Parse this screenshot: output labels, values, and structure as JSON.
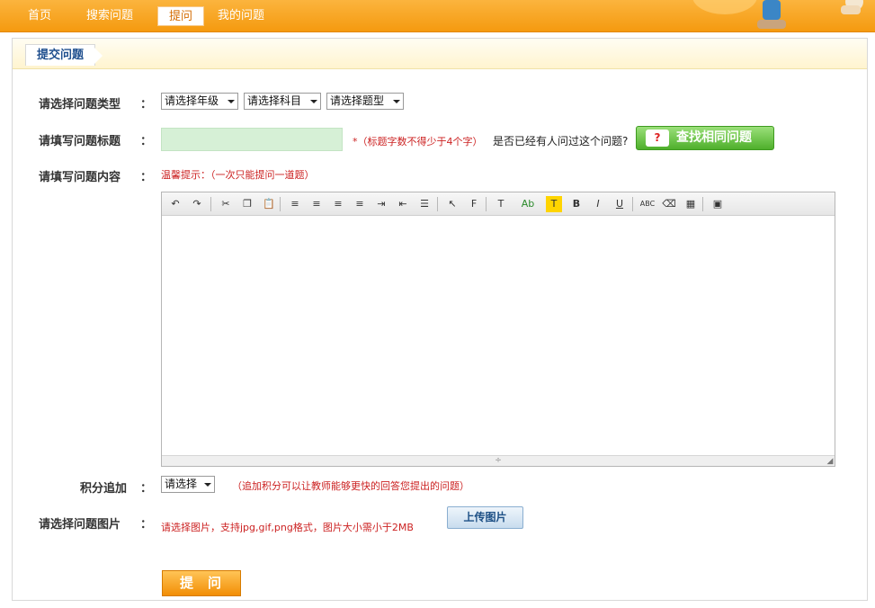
{
  "nav": {
    "items": [
      {
        "label": "首页"
      },
      {
        "label": "搜索问题"
      },
      {
        "label": "提问"
      },
      {
        "label": "我的问题"
      }
    ],
    "active_index": 2
  },
  "panel": {
    "tab_title": "提交问题"
  },
  "form": {
    "type_label": "请选择问题类型",
    "grade_select": "请选择年级",
    "subject_select": "请选择科目",
    "qtype_select": "请选择题型",
    "title_label": "请填写问题标题",
    "title_value": "",
    "title_hint": "*（标题字数不得少于4个字）",
    "title_question": "是否已经有人问过这个问题?",
    "find_button": "查找相同问题",
    "content_label": "请填写问题内容",
    "content_hint": "温馨提示：（一次只能提问一道题）",
    "points_label": "积分追加",
    "points_select": "请选择",
    "points_hint": "（追加积分可以让教师能够更快的回答您提出的问题）",
    "image_label": "请选择问题图片",
    "image_hint": "请选择图片，支持jpg,gif,png格式，图片大小需小于2MB",
    "upload_button": "上传图片",
    "submit_button": "提问",
    "colon": "："
  },
  "editor": {
    "toolbar": [
      {
        "icon": "undo-icon",
        "glyph": "↶"
      },
      {
        "icon": "redo-icon",
        "glyph": "↷"
      },
      {
        "icon": "cut-icon",
        "glyph": "✂"
      },
      {
        "icon": "copy-icon",
        "glyph": "❐"
      },
      {
        "icon": "paste-icon",
        "glyph": "📋"
      },
      {
        "icon": "align-left-icon",
        "glyph": "≡"
      },
      {
        "icon": "align-center-icon",
        "glyph": "≡"
      },
      {
        "icon": "align-right-icon",
        "glyph": "≡"
      },
      {
        "icon": "align-justify-icon",
        "glyph": "≡"
      },
      {
        "icon": "indent-icon",
        "glyph": "⇥"
      },
      {
        "icon": "outdent-icon",
        "glyph": "⇤"
      },
      {
        "icon": "numbered-list-icon",
        "glyph": "☰"
      },
      {
        "icon": "select-pointer-icon",
        "glyph": "↖"
      },
      {
        "icon": "font-family-icon",
        "glyph": "F"
      },
      {
        "icon": "font-size-icon",
        "glyph": "T"
      },
      {
        "icon": "font-color-icon",
        "glyph": "Ab"
      },
      {
        "icon": "highlight-icon",
        "glyph": "T"
      },
      {
        "icon": "bold-icon",
        "glyph": "B"
      },
      {
        "icon": "italic-icon",
        "glyph": "I"
      },
      {
        "icon": "underline-icon",
        "glyph": "U"
      },
      {
        "icon": "spellcheck-icon",
        "glyph": "ABC"
      },
      {
        "icon": "eraser-icon",
        "glyph": "⌫"
      },
      {
        "icon": "table-icon",
        "glyph": "▦"
      },
      {
        "icon": "insert-image-icon",
        "glyph": "▣"
      }
    ],
    "resize_glyph": "÷"
  }
}
